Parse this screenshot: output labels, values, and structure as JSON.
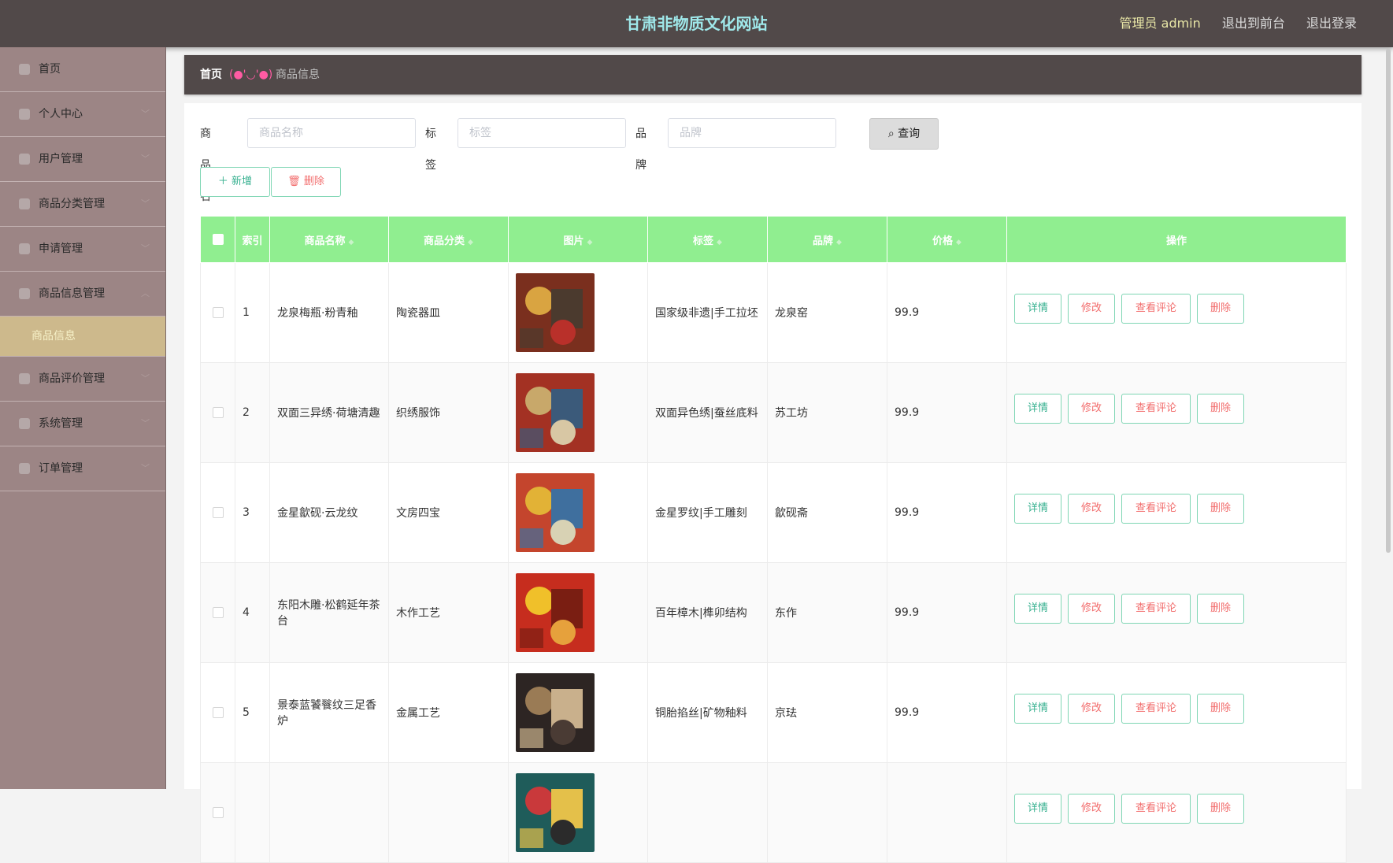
{
  "header": {
    "title": "甘肃非物质文化网站",
    "admin_label": "管理员 admin",
    "to_front": "退出到前台",
    "logout": "退出登录"
  },
  "sidebar": {
    "items": [
      {
        "label": "首页",
        "icon": "home-icon",
        "has_arrow": false
      },
      {
        "label": "个人中心",
        "icon": "user-icon",
        "has_arrow": true
      },
      {
        "label": "用户管理",
        "icon": "users-icon",
        "has_arrow": true
      },
      {
        "label": "商品分类管理",
        "icon": "category-icon",
        "has_arrow": true
      },
      {
        "label": "申请管理",
        "icon": "apply-icon",
        "has_arrow": true
      },
      {
        "label": "商品信息管理",
        "icon": "goods-icon",
        "has_arrow": true
      }
    ],
    "active_sub": "商品信息",
    "items_after": [
      {
        "label": "商品评价管理",
        "icon": "comment-icon"
      },
      {
        "label": "系统管理",
        "icon": "system-icon"
      },
      {
        "label": "订单管理",
        "icon": "order-icon"
      }
    ]
  },
  "breadcrumb": {
    "home": "首页",
    "face": "(●'◡'●)",
    "current": "商品信息"
  },
  "search": {
    "name_label": "商品名称",
    "name_placeholder": "商品名称",
    "tag_label": "标签",
    "tag_placeholder": "标签",
    "brand_label": "品牌",
    "brand_placeholder": "品牌",
    "button": "查询"
  },
  "actions": {
    "add": "＋ 新增",
    "delete": "删除"
  },
  "table": {
    "headers": [
      "索引",
      "商品名称",
      "商品分类",
      "图片",
      "标签",
      "品牌",
      "价格",
      "操作"
    ],
    "op_labels": {
      "detail": "详情",
      "edit": "修改",
      "comments": "查看评论",
      "delete": "删除"
    },
    "rows": [
      {
        "index": "1",
        "name": "龙泉梅瓶·粉青釉",
        "category": "陶瓷器皿",
        "tags": "国家级非遗|手工拉坯",
        "brand": "龙泉窑",
        "price": "99.9"
      },
      {
        "index": "2",
        "name": "双面三异绣·荷塘清趣",
        "category": "织绣服饰",
        "tags": "双面异色绣|蚕丝底料",
        "brand": "苏工坊",
        "price": "99.9"
      },
      {
        "index": "3",
        "name": "金星歙砚·云龙纹",
        "category": "文房四宝",
        "tags": "金星罗纹|手工雕刻",
        "brand": "歙砚斋",
        "price": "99.9"
      },
      {
        "index": "4",
        "name": "东阳木雕·松鹤延年茶台",
        "category": "木作工艺",
        "tags": "百年樟木|榫卯结构",
        "brand": "东作",
        "price": "99.9"
      },
      {
        "index": "5",
        "name": "景泰蓝饕餮纹三足香炉",
        "category": "金属工艺",
        "tags": "铜胎掐丝|矿物釉料",
        "brand": "京珐",
        "price": "99.9"
      },
      {
        "index": "",
        "name": "",
        "category": "",
        "tags": "",
        "brand": "",
        "price": ""
      }
    ]
  },
  "colors": {
    "header_bg": "#514949",
    "sidebar_bg": "#9c8585",
    "active_bg": "#cdb98c",
    "table_header": "#90ee90",
    "title": "#9fe8ea"
  }
}
